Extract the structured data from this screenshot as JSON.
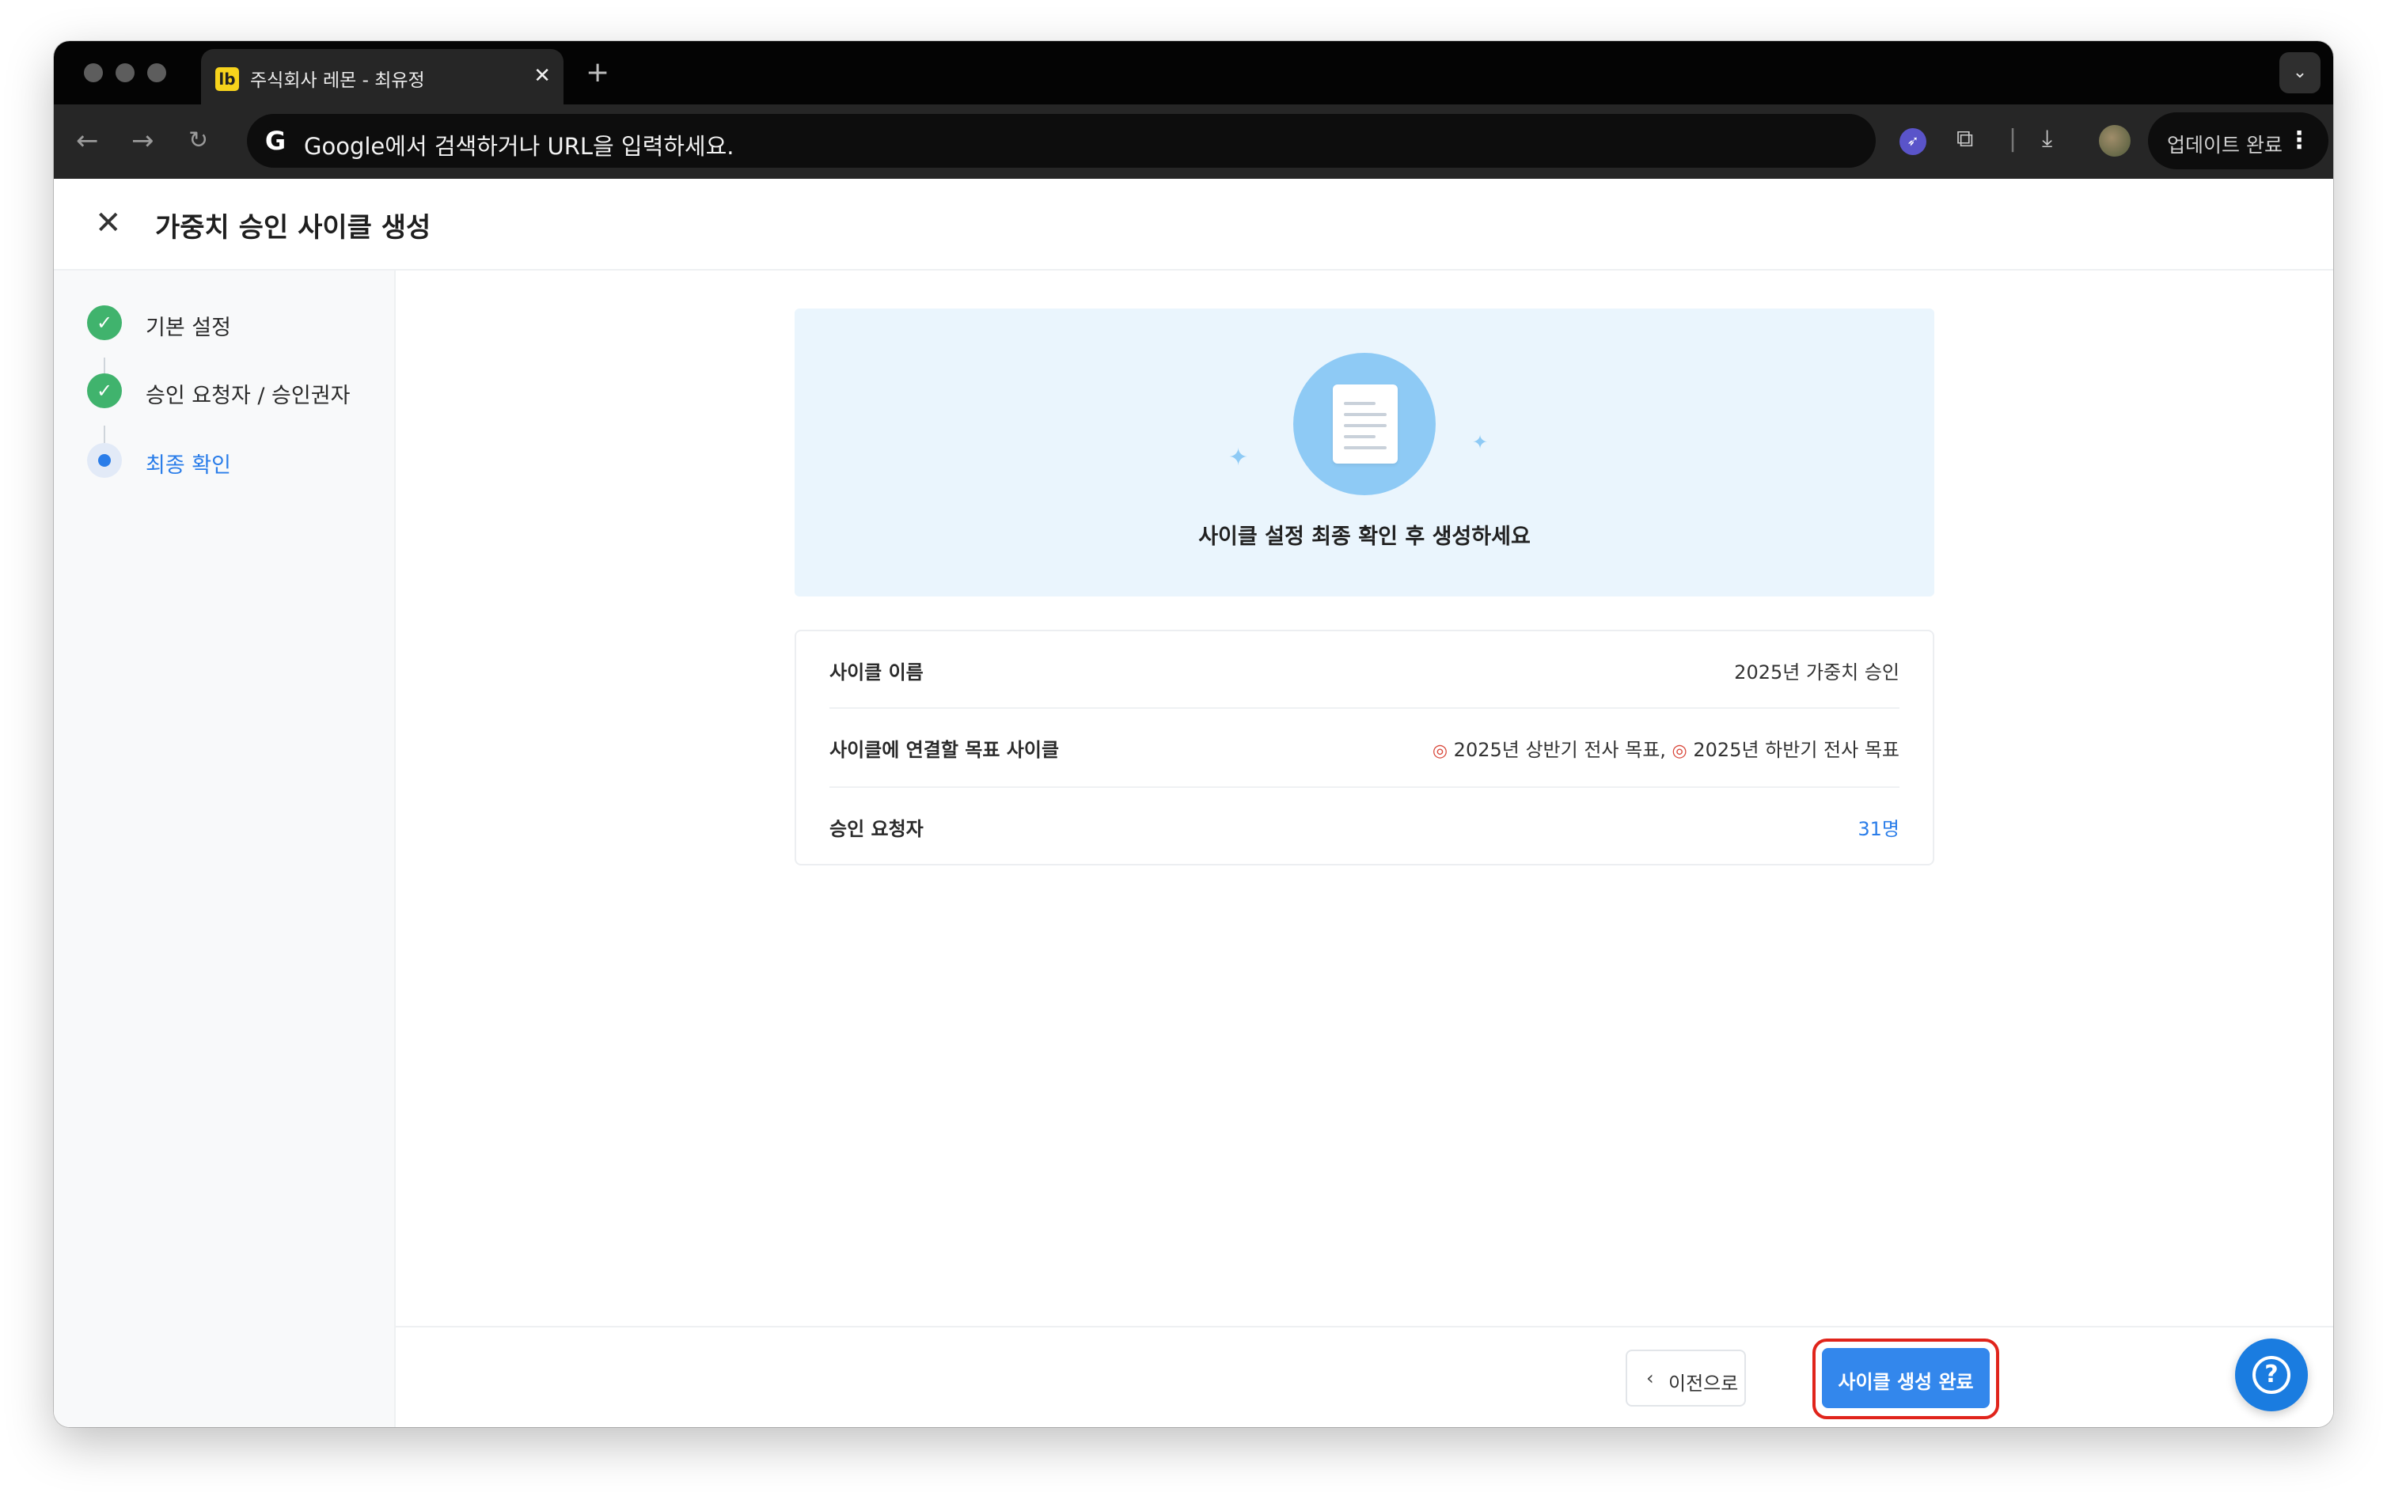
{
  "browser": {
    "tab_title": "주식회사 레몬 - 최유정",
    "tab_favicon": "lb",
    "tab_close": "✕",
    "new_tab": "+",
    "tab_search": "⌄",
    "omnibox_placeholder": "Google에서 검색하거나 URL을 입력하세요.",
    "omnibox_icon": "G",
    "update_label": "업데이트 완료",
    "update_menu": "⋮"
  },
  "header": {
    "close": "✕",
    "title": "가중치 승인 사이클 생성"
  },
  "steps": [
    {
      "label": "기본 설정",
      "status": "done"
    },
    {
      "label": "승인 요청자 / 승인권자",
      "status": "done"
    },
    {
      "label": "최종 확인",
      "status": "current"
    }
  ],
  "hero": {
    "message": "사이클 설정 최종 확인 후 생성하세요"
  },
  "summary": {
    "rows": [
      {
        "label": "사이클 이름",
        "value": "2025년 가중치 승인"
      },
      {
        "label": "사이클에 연결할 목표 사이클",
        "value": "2025년 상반기 전사 목표, 2025년 하반기 전사 목표",
        "value_part1": "2025년 상반기 전사 목표,",
        "value_part2": "2025년 하반기 전사 목표"
      },
      {
        "label": "승인 요청자",
        "value": "31명"
      }
    ]
  },
  "footer": {
    "prev_label": "이전으로",
    "finish_label": "사이클 생성 완료"
  },
  "help": {
    "label": "?"
  },
  "colors": {
    "accent": "#3387ec",
    "success": "#40b36d",
    "highlight": "#e0241b",
    "hero_bg": "#eaf5fd"
  }
}
